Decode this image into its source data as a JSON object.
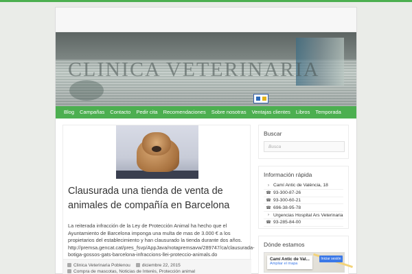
{
  "theme": {
    "accent": "#4caf50",
    "background": "#eaece8"
  },
  "banner": {
    "sign_text": "CLINICA VETERINARIA"
  },
  "nav": {
    "items": [
      {
        "label": "Blog"
      },
      {
        "label": "Campañas"
      },
      {
        "label": "Contacto"
      },
      {
        "label": "Pedir cita"
      },
      {
        "label": "Recomendaciones"
      },
      {
        "label": "Sobre nosotras"
      },
      {
        "label": "Ventajas clientes"
      },
      {
        "label": "Libros"
      },
      {
        "label": "Temporada"
      }
    ]
  },
  "post": {
    "image_subject": "shar-pei puppy",
    "title": "Clausurada una tienda de venta de animales de compañía en Barcelona",
    "body": "La reiterada infracción de la Ley de Protección Animal ha hecho que el Ayuntamiento de Barcelona imponga una multa de mas de 3.000 € a los propietarios del establecimiento  y han clausurado la tienda durante dos años. http://premsa.gencat.cat/pres_fsvp/AppJava/notapremsavw/289747/ca/clausurada-botiga-gossos-gats-barcelona-infraccions-llei-proteccio-animals.do",
    "meta": {
      "author": "Clinica Veterinaria Poblenou",
      "date": "diciembre 22, 2015",
      "categories": "Compra de mascotas, Noticias de Interés, Protección animal"
    }
  },
  "sidebar": {
    "search": {
      "title": "Buscar",
      "placeholder": "Busca"
    },
    "info": {
      "title": "Información rápida",
      "items": [
        {
          "icon": "location-arrow-icon",
          "text": "Camí Antic de València, 18"
        },
        {
          "icon": "phone-icon",
          "text": "93-300-87-26"
        },
        {
          "icon": "phone-icon",
          "text": "93-300-60-21"
        },
        {
          "icon": "phone-icon",
          "text": "696-38-95-78"
        },
        {
          "icon": "arrow-icon",
          "text": "Urgencias Hospital Ars Veterinaria"
        },
        {
          "icon": "phone-icon",
          "text": "93-285-84-00"
        }
      ]
    },
    "map": {
      "title": "Dónde estamos",
      "address": "Camí Antic de Val...",
      "enlarge_link": "Ampliar el mapa",
      "login_button": "Iniciar sesión"
    }
  }
}
